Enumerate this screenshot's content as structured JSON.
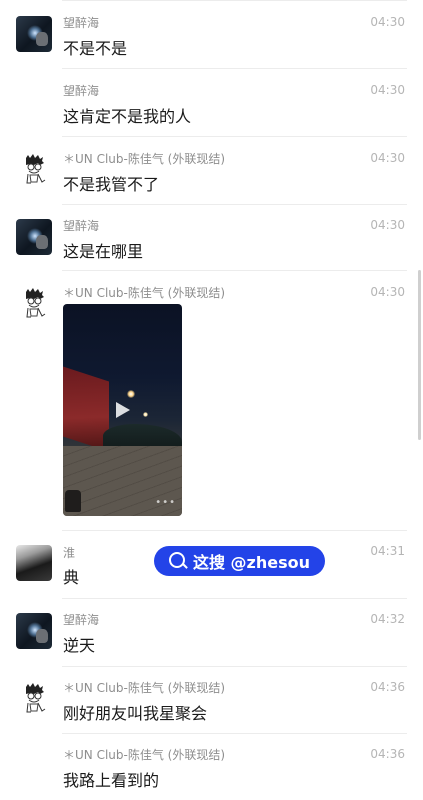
{
  "messages": [
    {
      "sender": "望醉海",
      "time": "04:30",
      "text": "不是不是",
      "avatar": "photo-avatar"
    },
    {
      "sender": "望醉海",
      "time": "04:30",
      "text": "这肯定不是我的人",
      "avatar": null
    },
    {
      "sender": "＊UN Club-陈佳气 (外联现结)",
      "time": "04:30",
      "text": "不是我管不了",
      "avatar": "sketch-avatar"
    },
    {
      "sender": "望醉海",
      "time": "04:30",
      "text": "这是在哪里",
      "avatar": "photo-avatar"
    },
    {
      "sender": "＊UN Club-陈佳气 (外联现结)",
      "time": "04:30",
      "text": "",
      "avatar": "sketch-avatar",
      "video": true
    },
    {
      "sender": "淮",
      "time": "04:31",
      "text": "典",
      "avatar": "dark-avatar"
    },
    {
      "sender": "望醉海",
      "time": "04:32",
      "text": "逆天",
      "avatar": "photo-avatar"
    },
    {
      "sender": "＊UN Club-陈佳气 (外联现结)",
      "time": "04:36",
      "text": "刚好朋友叫我星聚会",
      "avatar": "sketch-avatar"
    },
    {
      "sender": "＊UN Club-陈佳气 (外联现结)",
      "time": "04:36",
      "text": "我路上看到的",
      "avatar": null
    }
  ],
  "video": {
    "play_icon": "play-icon",
    "more_icon": "more-dots-icon"
  },
  "watermark": {
    "text": "这搜 @zhesou",
    "icon": "search-icon",
    "color": "#2343e8"
  }
}
